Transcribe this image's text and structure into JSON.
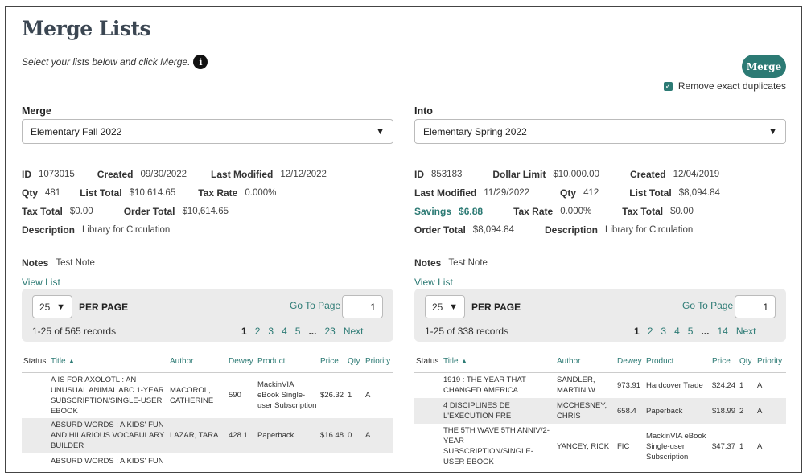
{
  "page": {
    "title": "Merge Lists",
    "subtitle": "Select your lists below and click Merge.",
    "merge_button": "Merge",
    "remove_duplicates_label": "Remove exact duplicates"
  },
  "left": {
    "label": "Merge",
    "selected": "Elementary Fall 2022",
    "id_label": "ID",
    "id": "1073015",
    "created_label": "Created",
    "created": "09/30/2022",
    "last_modified_label": "Last Modified",
    "last_modified": "12/12/2022",
    "qty_label": "Qty",
    "qty": "481",
    "list_total_label": "List Total",
    "list_total": "$10,614.65",
    "tax_rate_label": "Tax Rate",
    "tax_rate": "0.000%",
    "tax_total_label": "Tax Total",
    "tax_total": "$0.00",
    "order_total_label": "Order Total",
    "order_total": "$10,614.65",
    "description_label": "Description",
    "description": "Library for Circulation",
    "notes_label": "Notes",
    "notes": "Test Note",
    "view_list": "View List",
    "per_page": "25",
    "per_page_label": "PER PAGE",
    "goto_label": "Go To Page",
    "goto_value": "1",
    "records": "1-25 of 565 records",
    "pages": [
      "1",
      "2",
      "3",
      "4",
      "5",
      "...",
      "23",
      "Next"
    ],
    "columns": [
      "Status",
      "Title",
      "Author",
      "Dewey",
      "Product",
      "Price",
      "Qty",
      "Priority"
    ],
    "rows": [
      {
        "status": "",
        "title": "A IS FOR AXOLOTL : AN UNUSUAL ANIMAL ABC 1-YEAR SUBSCRIPTION/SINGLE-USER EBOOK",
        "author": "MACOROL, CATHERINE",
        "dewey": "590",
        "product": "MackinVIA eBook Single-user Subscription",
        "price": "$26.32",
        "qty": "1",
        "priority": "A"
      },
      {
        "status": "",
        "title": "ABSURD WORDS : A KIDS' FUN AND HILARIOUS VOCABULARY BUILDER",
        "author": "LAZAR, TARA",
        "dewey": "428.1",
        "product": "Paperback",
        "price": "$16.48",
        "qty": "0",
        "priority": "A"
      },
      {
        "status": "",
        "title": "ABSURD WORDS : A KIDS' FUN",
        "author": "",
        "dewey": "",
        "product": "",
        "price": "",
        "qty": "",
        "priority": ""
      }
    ]
  },
  "right": {
    "label": "Into",
    "selected": "Elementary Spring 2022",
    "id_label": "ID",
    "id": "853183",
    "dollar_limit_label": "Dollar Limit",
    "dollar_limit": "$10,000.00",
    "created_label": "Created",
    "created": "12/04/2019",
    "last_modified_label": "Last Modified",
    "last_modified": "11/29/2022",
    "qty_label": "Qty",
    "qty": "412",
    "list_total_label": "List Total",
    "list_total": "$8,094.84",
    "savings_label": "Savings",
    "savings": "$6.88",
    "tax_rate_label": "Tax Rate",
    "tax_rate": "0.000%",
    "tax_total_label": "Tax Total",
    "tax_total": "$0.00",
    "order_total_label": "Order Total",
    "order_total": "$8,094.84",
    "description_label": "Description",
    "description": "Library for Circulation",
    "notes_label": "Notes",
    "notes": "Test Note",
    "view_list": "View List",
    "per_page": "25",
    "per_page_label": "PER PAGE",
    "goto_label": "Go To Page",
    "goto_value": "1",
    "records": "1-25 of 338 records",
    "pages": [
      "1",
      "2",
      "3",
      "4",
      "5",
      "...",
      "14",
      "Next"
    ],
    "columns": [
      "Status",
      "Title",
      "Author",
      "Dewey",
      "Product",
      "Price",
      "Qty",
      "Priority"
    ],
    "rows": [
      {
        "status": "",
        "title": "1919 : THE YEAR THAT CHANGED AMERICA",
        "author": "SANDLER, MARTIN W",
        "dewey": "973.91",
        "product": "Hardcover Trade",
        "price": "$24.24",
        "qty": "1",
        "priority": "A"
      },
      {
        "status": "",
        "title": "4 DISCIPLINES DE L'EXECUTION FRE",
        "author": "MCCHESNEY, CHRIS",
        "dewey": "658.4",
        "product": "Paperback",
        "price": "$18.99",
        "qty": "2",
        "priority": "A"
      },
      {
        "status": "",
        "title": "THE 5TH WAVE 5TH ANNIV/2-YEAR SUBSCRIPTION/SINGLE-USER EBOOK",
        "author": "YANCEY, RICK",
        "dewey": "FIC",
        "product": "MackinVIA eBook Single-user Subscription",
        "price": "$47.37",
        "qty": "1",
        "priority": "A"
      }
    ]
  },
  "colors": {
    "accent": "#2c7a74",
    "title": "#3b4652",
    "stripe": "#ebebeb"
  },
  "icons": {
    "info": "info-icon",
    "caret": "caret-down-icon",
    "sort": "sort-asc-icon",
    "check": "checkmark-icon"
  }
}
